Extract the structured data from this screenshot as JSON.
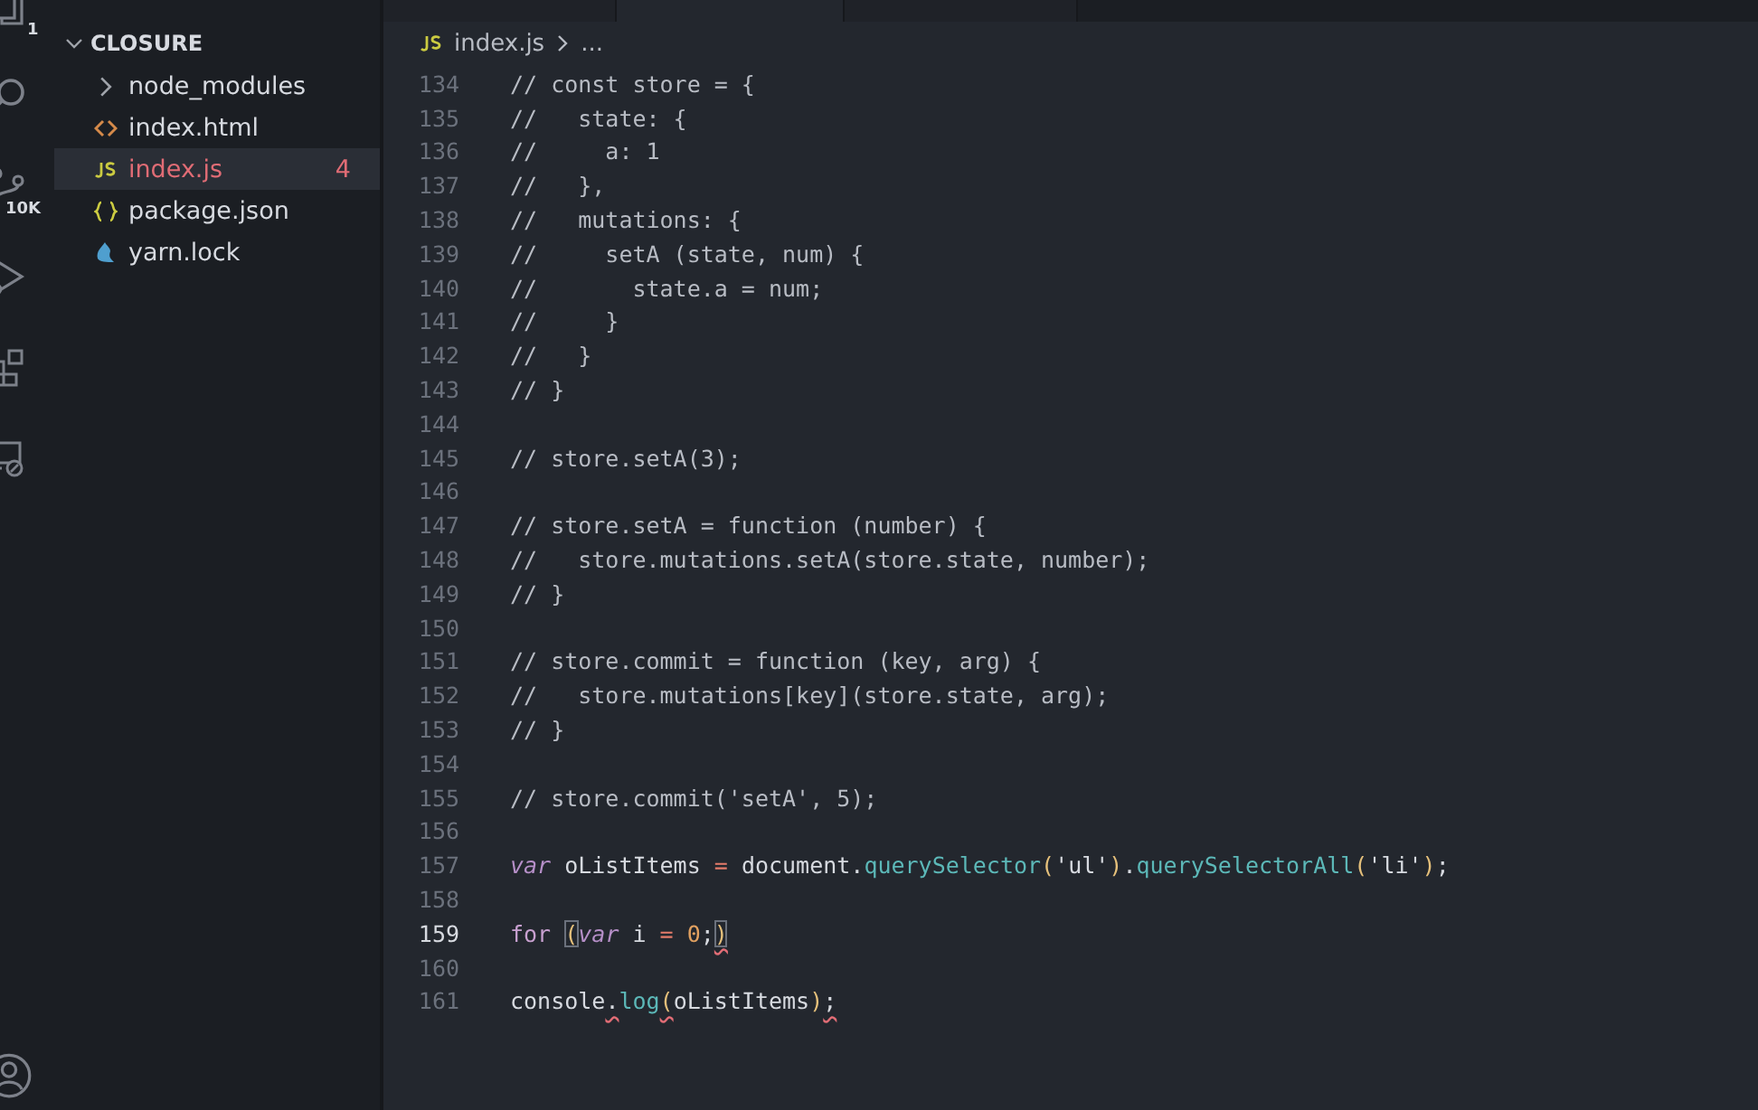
{
  "activity_bar": {
    "items": [
      {
        "kind": "files",
        "badge": "1",
        "selected": false
      },
      {
        "kind": "search",
        "selected": false
      },
      {
        "kind": "source-control",
        "badge": "10K",
        "selected": false
      },
      {
        "kind": "run",
        "selected": false
      },
      {
        "kind": "extensions",
        "selected": false
      },
      {
        "kind": "remote",
        "selected": false
      }
    ]
  },
  "explorer": {
    "folder": "CLOSURE",
    "expanded": true,
    "items": [
      {
        "kind": "folder",
        "name": "node_modules",
        "expanded": false,
        "selected": false
      },
      {
        "kind": "html",
        "name": "index.html",
        "selected": false
      },
      {
        "kind": "js",
        "name": "index.js",
        "badge": "4",
        "error": true,
        "selected": true
      },
      {
        "kind": "json",
        "name": "package.json",
        "selected": false
      },
      {
        "kind": "yarn",
        "name": "yarn.lock",
        "selected": false
      }
    ]
  },
  "editor": {
    "tabs": [
      {
        "selected": false
      },
      {
        "selected": true
      },
      {
        "selected": false
      }
    ],
    "breadcrumb": {
      "file": "index.js",
      "rest": "..."
    },
    "lines": [
      {
        "number": "134",
        "current": false,
        "tokens": [
          {
            "kind": "comment",
            "text": "// const store = {"
          }
        ]
      },
      {
        "number": "135",
        "current": false,
        "tokens": [
          {
            "kind": "comment",
            "text": "//   state: {"
          }
        ]
      },
      {
        "number": "136",
        "current": false,
        "tokens": [
          {
            "kind": "comment",
            "text": "//     a: 1"
          }
        ]
      },
      {
        "number": "137",
        "current": false,
        "tokens": [
          {
            "kind": "comment",
            "text": "//   },"
          }
        ]
      },
      {
        "number": "138",
        "current": false,
        "tokens": [
          {
            "kind": "comment",
            "text": "//   mutations: {"
          }
        ]
      },
      {
        "number": "139",
        "current": false,
        "tokens": [
          {
            "kind": "comment",
            "text": "//     setA (state, num) {"
          }
        ]
      },
      {
        "number": "140",
        "current": false,
        "tokens": [
          {
            "kind": "comment",
            "text": "//       state.a = num;"
          }
        ]
      },
      {
        "number": "141",
        "current": false,
        "tokens": [
          {
            "kind": "comment",
            "text": "//     }"
          }
        ]
      },
      {
        "number": "142",
        "current": false,
        "tokens": [
          {
            "kind": "comment",
            "text": "//   }"
          }
        ]
      },
      {
        "number": "143",
        "current": false,
        "tokens": [
          {
            "kind": "comment",
            "text": "// }"
          }
        ]
      },
      {
        "number": "144",
        "current": false
      },
      {
        "number": "145",
        "current": false,
        "tokens": [
          {
            "kind": "comment",
            "text": "// store.setA(3);"
          }
        ]
      },
      {
        "number": "146",
        "current": false
      },
      {
        "number": "147",
        "current": false,
        "tokens": [
          {
            "kind": "comment",
            "text": "// store.setA = function (number) {"
          }
        ]
      },
      {
        "number": "148",
        "current": false,
        "tokens": [
          {
            "kind": "comment",
            "text": "//   store.mutations.setA(store.state, number);"
          }
        ]
      },
      {
        "number": "149",
        "current": false,
        "tokens": [
          {
            "kind": "comment",
            "text": "// }"
          }
        ]
      },
      {
        "number": "150",
        "current": false
      },
      {
        "number": "151",
        "current": false,
        "tokens": [
          {
            "kind": "comment",
            "text": "// store.commit = function (key, arg) {"
          }
        ]
      },
      {
        "number": "152",
        "current": false,
        "tokens": [
          {
            "kind": "comment",
            "text": "//   store.mutations[key](store.state, arg);"
          }
        ]
      },
      {
        "number": "153",
        "current": false,
        "tokens": [
          {
            "kind": "comment",
            "text": "// }"
          }
        ]
      },
      {
        "number": "154",
        "current": false
      },
      {
        "number": "155",
        "current": false,
        "tokens": [
          {
            "kind": "comment",
            "text": "// store.commit('setA', 5);"
          }
        ]
      },
      {
        "number": "156",
        "current": false
      },
      {
        "number": "157",
        "current": false,
        "tokens": [
          {
            "kind": "storage",
            "text": "var"
          },
          {
            "kind": "plain",
            "text": " oListItems "
          },
          {
            "kind": "operator",
            "text": "="
          },
          {
            "kind": "plain",
            "text": " document."
          },
          {
            "kind": "method",
            "text": "querySelector"
          },
          {
            "kind": "bracket",
            "text": "("
          },
          {
            "kind": "string",
            "text": "'ul'"
          },
          {
            "kind": "bracket",
            "text": ")"
          },
          {
            "kind": "plain",
            "text": "."
          },
          {
            "kind": "method",
            "text": "querySelectorAll"
          },
          {
            "kind": "bracket",
            "text": "("
          },
          {
            "kind": "string",
            "text": "'li'"
          },
          {
            "kind": "bracket",
            "text": ")"
          },
          {
            "kind": "plain",
            "text": ";"
          }
        ]
      },
      {
        "number": "158",
        "current": false
      },
      {
        "number": "159",
        "current": true,
        "tokens": [
          {
            "kind": "keyword",
            "text": "for "
          },
          {
            "kind": "bracket",
            "text": "(",
            "matched": true
          },
          {
            "kind": "storage",
            "text": "var"
          },
          {
            "kind": "plain",
            "text": " i "
          },
          {
            "kind": "operator",
            "text": "="
          },
          {
            "kind": "number",
            "text": " 0"
          },
          {
            "kind": "plain",
            "text": ";"
          },
          {
            "kind": "bracket",
            "text": ")",
            "matched": true,
            "error": true
          }
        ]
      },
      {
        "number": "160",
        "current": false
      },
      {
        "number": "161",
        "current": false,
        "tokens": [
          {
            "kind": "plain",
            "text": "console"
          },
          {
            "kind": "plain",
            "text": ".",
            "error": true
          },
          {
            "kind": "method",
            "text": "log"
          },
          {
            "kind": "bracket",
            "text": "(",
            "error": true
          },
          {
            "kind": "plain",
            "text": "oListItems"
          },
          {
            "kind": "bracket",
            "text": ")"
          },
          {
            "kind": "plain",
            "text": ";",
            "error": true
          }
        ]
      }
    ]
  }
}
